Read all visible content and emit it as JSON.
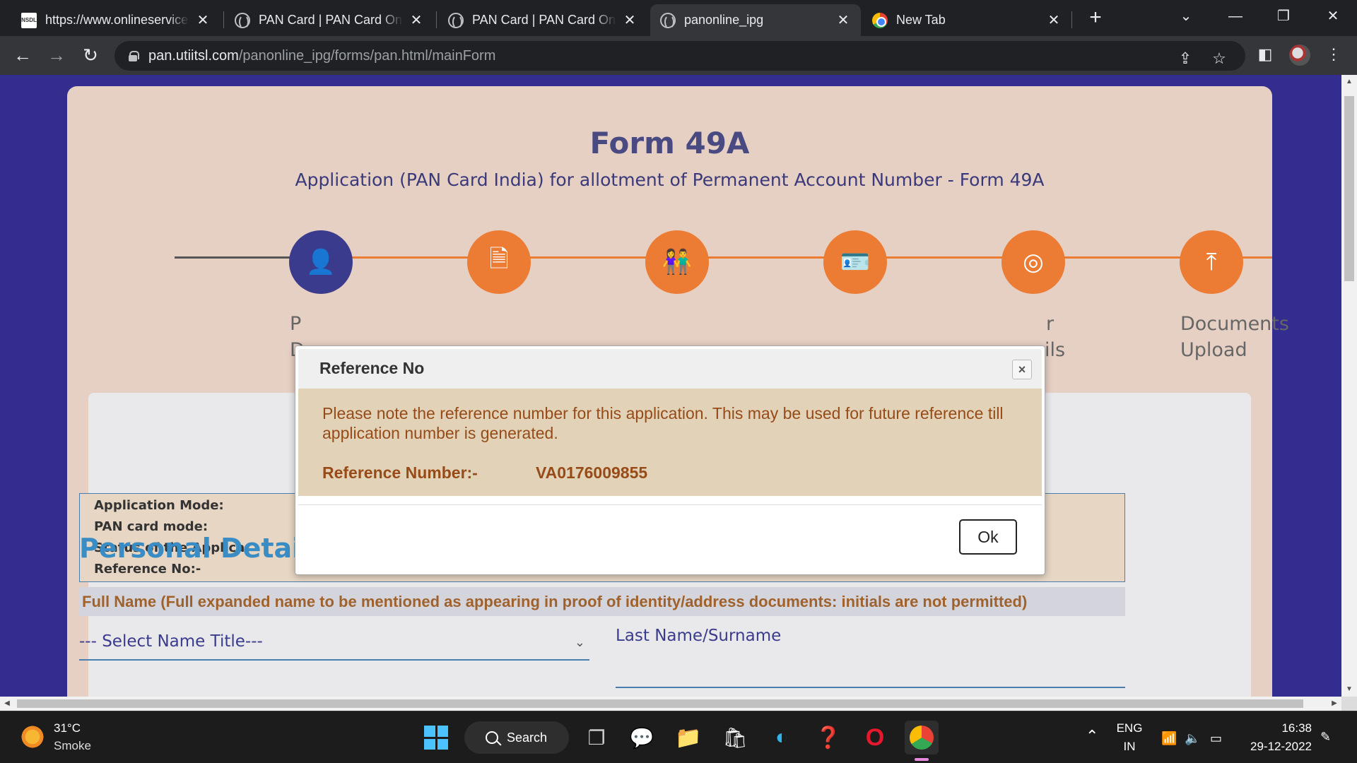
{
  "browser": {
    "tabs": [
      {
        "title": "https://www.onlineservices.nsdl.com",
        "favicon": "nsdl-icon",
        "active": false
      },
      {
        "title": "PAN Card | PAN Card Online",
        "favicon": "globe-icon",
        "active": false
      },
      {
        "title": "PAN Card | PAN Card Online",
        "favicon": "globe-icon",
        "active": false
      },
      {
        "title": "panonline_ipg",
        "favicon": "globe-icon",
        "active": true
      },
      {
        "title": "New Tab",
        "favicon": "chrome-icon",
        "active": false
      }
    ],
    "url_host": "pan.utiitsl.com",
    "url_path": "/panonline_ipg/forms/pan.html/mainForm"
  },
  "page": {
    "title": "Form 49A",
    "subtitle": "Application (PAN Card India) for allotment of Permanent Account Number - Form 49A",
    "steps": [
      {
        "icon": "person-icon",
        "label": "",
        "current": true
      },
      {
        "icon": "document-icon",
        "label": "",
        "current": false
      },
      {
        "icon": "people-icon",
        "label": "",
        "current": false
      },
      {
        "icon": "contact-card-icon",
        "label": "",
        "current": false
      },
      {
        "icon": "target-icon",
        "label": "",
        "current": false
      },
      {
        "icon": "upload-icon",
        "label": "Documents Upload",
        "current": false
      }
    ],
    "partial_labels": {
      "step1_a": "P",
      "step1_b": "D",
      "step5_a": "r",
      "step5_b": "ils"
    },
    "info_rows": [
      "Application Mode:",
      "PAN card mode:",
      "Status of the Applica",
      "Reference No:-"
    ],
    "section_title": "Personal Details:",
    "fullname_note": "Full Name (Full expanded name to be mentioned as appearing in proof of identity/address documents: initials are not permitted)",
    "name_title_select": "--- Select Name Title---",
    "last_name_label": "Last Name/Surname"
  },
  "modal": {
    "title": "Reference No",
    "close_glyph": "×",
    "message": "Please note the reference number for this application. This may be used for future reference till application number is generated.",
    "ref_label": "Reference Number:-",
    "ref_value": "VA0176009855",
    "ok_label": "Ok"
  },
  "taskbar": {
    "temp": "31°C",
    "weather": "Smoke",
    "search_label": "Search",
    "lang1": "ENG",
    "lang2": "IN",
    "time": "16:38",
    "date": "29-12-2022"
  },
  "colors": {
    "page_bg": "#332d8f",
    "card_bg": "#e6cfc3",
    "step_orange": "#ec7c34",
    "step_current": "#3b3b8e",
    "modal_body": "#e2d3b8",
    "modal_text": "#964b18"
  }
}
